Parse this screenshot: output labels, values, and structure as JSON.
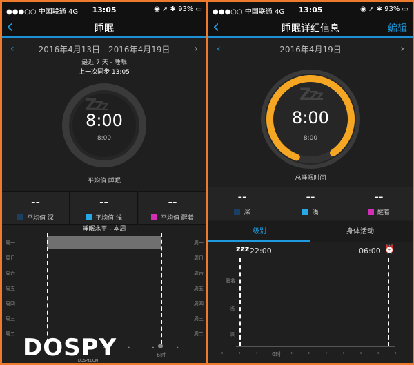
{
  "left": {
    "status": {
      "carrier": "●●●○○ 中国联通",
      "network": "4G",
      "time": "13:05",
      "battery": "93%"
    },
    "nav": {
      "title": "睡眠"
    },
    "range": "2016年4月13日 - 2016年4月19日",
    "range_sub": "最近 7 天 - 睡眠",
    "sync": "上一次同步 13:05",
    "ring": {
      "big": "8:00",
      "small": "8:00",
      "progress": 0
    },
    "ring_caption": "平均值 睡眠",
    "stats": [
      {
        "value": "--",
        "label": "平均值 深",
        "color": "#1b3f63"
      },
      {
        "value": "--",
        "label": "平均值 浅",
        "color": "#29a8e8"
      },
      {
        "value": "--",
        "label": "平均值 醒着",
        "color": "#d12fb5"
      }
    ],
    "chart": {
      "title": "睡眠水平 - 本周",
      "days": [
        "周一",
        "周日",
        "周六",
        "周五",
        "周四",
        "周三",
        "周二"
      ],
      "xlabel": "6时"
    }
  },
  "right": {
    "status": {
      "carrier": "●●●○○ 中国联通",
      "network": "4G",
      "time": "13:05",
      "battery": "93%"
    },
    "nav": {
      "title": "睡眠详细信息",
      "edit": "编辑"
    },
    "date": "2016年4月19日",
    "ring": {
      "big": "8:00",
      "small": "8:00",
      "progress": 0.85
    },
    "ring_caption": "总睡眠时间",
    "stats": [
      {
        "value": "--",
        "label": "深",
        "color": "#1b3f63"
      },
      {
        "value": "--",
        "label": "浅",
        "color": "#29a8e8"
      },
      {
        "value": "--",
        "label": "醒着",
        "color": "#d12fb5"
      }
    ],
    "tabs": [
      "级别",
      "身体活动"
    ],
    "chart": {
      "start": "22:00",
      "end": "06:00",
      "levels": [
        "醒着",
        "浅",
        "深"
      ],
      "xlabel": "0时"
    }
  },
  "watermark": {
    "logo": "DOSPY",
    "sub": "DOSPY.COM"
  },
  "colors": {
    "accent": "#1e9be0",
    "ring": "#f5a623",
    "frame": "#ee7a2e"
  }
}
